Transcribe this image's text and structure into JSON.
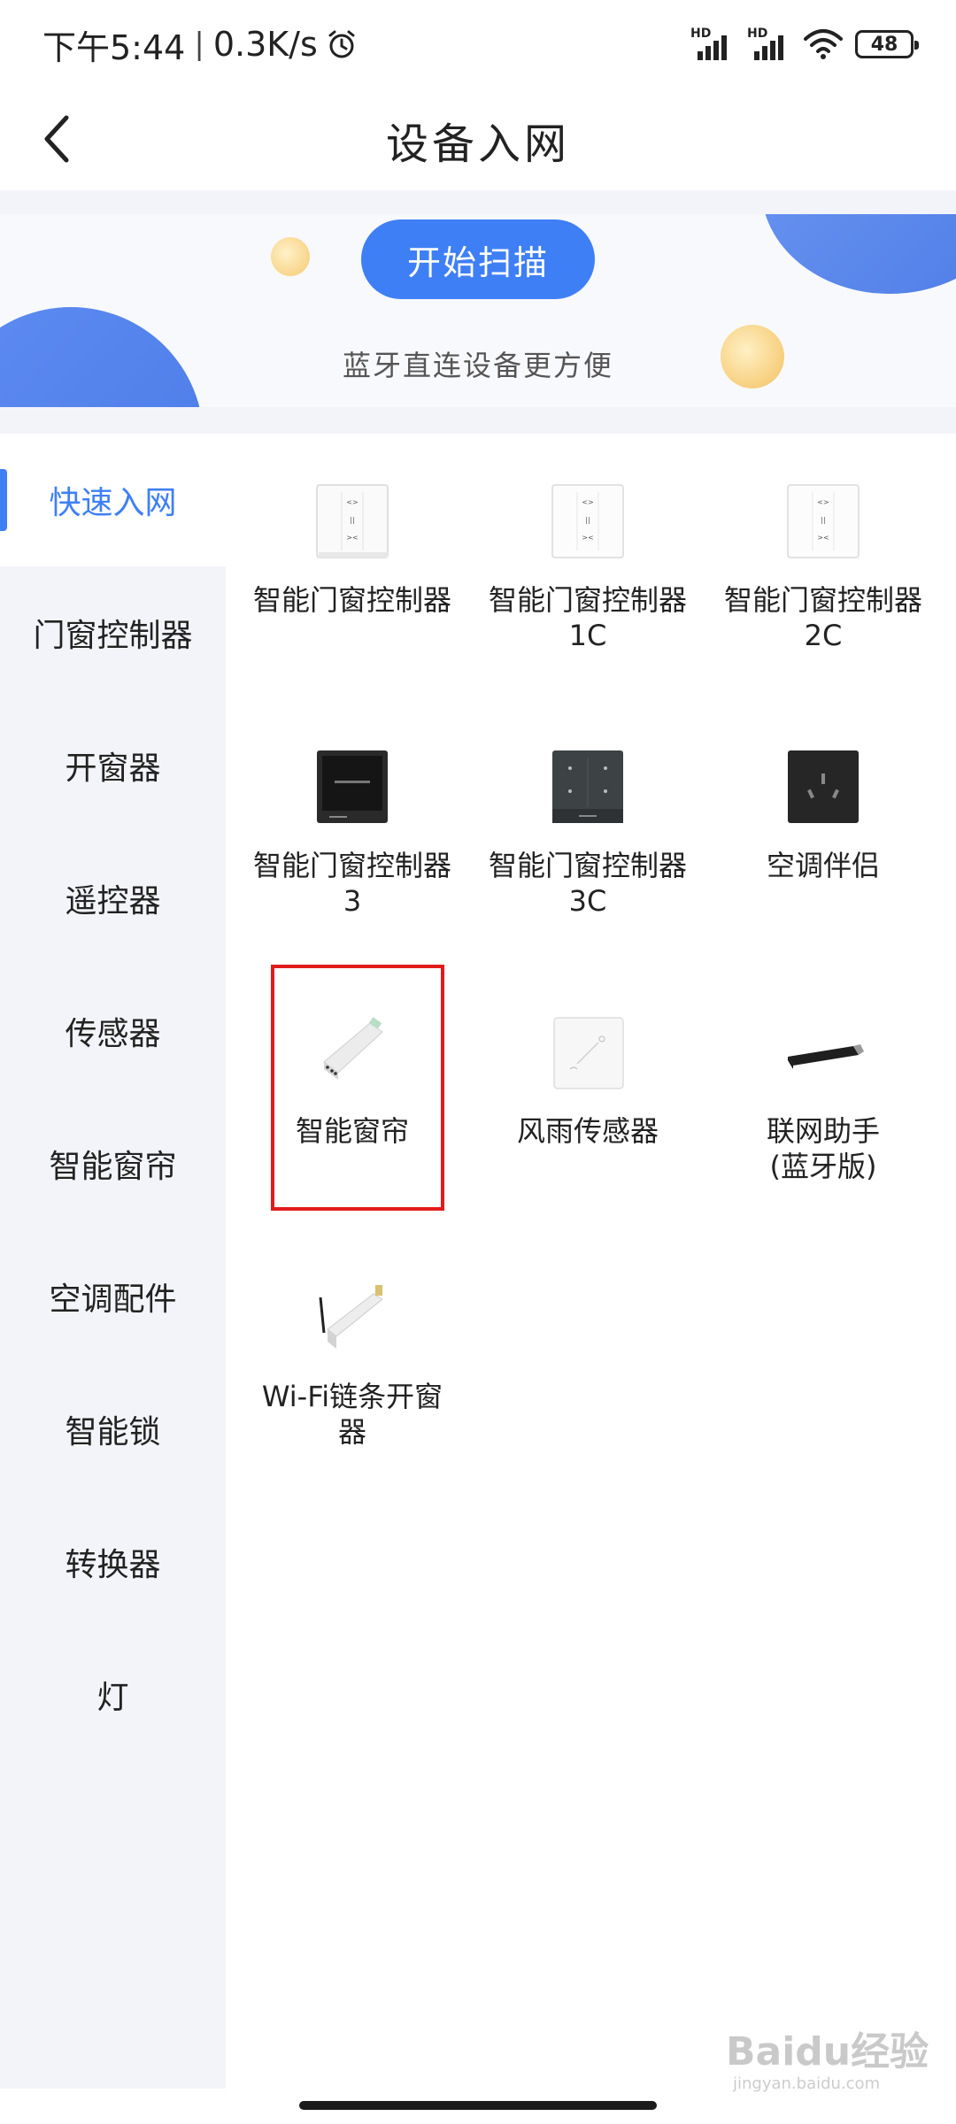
{
  "status_bar": {
    "time": "下午5:44",
    "separator": "|",
    "net_speed": "0.3K/s",
    "sim1_label": "HD",
    "sim2_label": "HD",
    "battery": "48"
  },
  "header": {
    "title": "设备入网",
    "back_icon": "chevron-left-icon"
  },
  "banner": {
    "scan_button": "开始扫描",
    "subtitle": "蓝牙直连设备更方便",
    "accent_color": "#3f7ff5"
  },
  "sidebar": {
    "items": [
      {
        "label": "快速入网",
        "active": true
      },
      {
        "label": "门窗控制器",
        "active": false
      },
      {
        "label": "开窗器",
        "active": false
      },
      {
        "label": "遥控器",
        "active": false
      },
      {
        "label": "传感器",
        "active": false
      },
      {
        "label": "智能窗帘",
        "active": false
      },
      {
        "label": "空调配件",
        "active": false
      },
      {
        "label": "智能锁",
        "active": false
      },
      {
        "label": "转换器",
        "active": false
      },
      {
        "label": "灯",
        "active": false
      }
    ]
  },
  "devices": [
    {
      "label": "智能门窗控制器",
      "icon": "white-switch-panel-icon"
    },
    {
      "label": "智能门窗控制器\n1C",
      "icon": "white-switch-panel-icon"
    },
    {
      "label": "智能门窗控制器\n2C",
      "icon": "white-switch-panel-icon"
    },
    {
      "label": "智能门窗控制器\n3",
      "icon": "black-screen-panel-icon"
    },
    {
      "label": "智能门窗控制器\n3C",
      "icon": "dark-switch-panel-icon"
    },
    {
      "label": "空调伴侣",
      "icon": "black-socket-panel-icon"
    },
    {
      "label": "智能窗帘",
      "icon": "curtain-motor-icon"
    },
    {
      "label": "风雨传感器",
      "icon": "rain-sensor-icon"
    },
    {
      "label": "联网助手\n(蓝牙版)",
      "icon": "usb-dongle-icon"
    },
    {
      "label": "Wi-Fi链条开窗\n器",
      "icon": "chain-window-opener-icon"
    }
  ],
  "highlighted_device": "智能窗帘",
  "watermark": {
    "brand": "Baidu经验",
    "url": "jingyan.baidu.com"
  }
}
